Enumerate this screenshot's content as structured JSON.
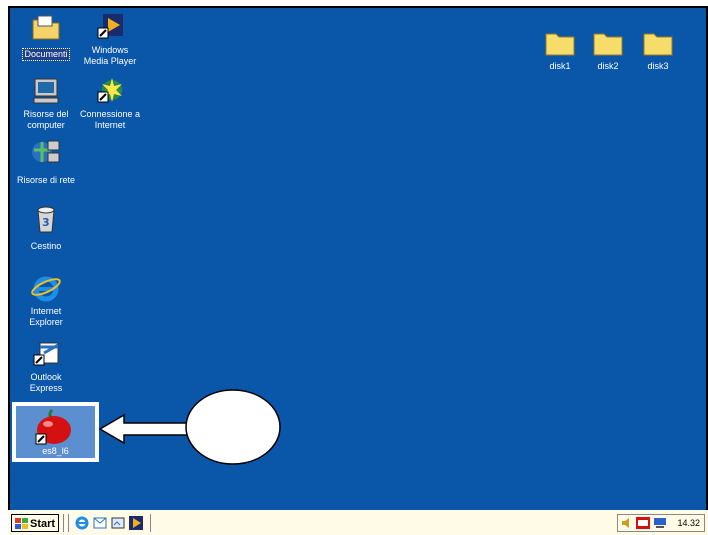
{
  "desktop": {
    "icons_left": [
      {
        "label": "Documenti",
        "icon": "folder-documents-icon"
      },
      {
        "label": "Windows\nMedia Player",
        "icon": "media-player-icon"
      },
      {
        "label": "Risorse del\ncomputer",
        "icon": "computer-icon"
      },
      {
        "label": "Connessione a\nInternet",
        "icon": "internet-connection-icon"
      },
      {
        "label": "Risorse di rete",
        "icon": "network-icon"
      },
      {
        "label": "Cestino",
        "icon": "recycle-bin-icon"
      },
      {
        "label": "Internet\nExplorer",
        "icon": "internet-explorer-icon"
      },
      {
        "label": "Outlook\nExpress",
        "icon": "outlook-express-icon"
      },
      {
        "label": "es8_l6",
        "icon": "apple-shortcut-icon"
      }
    ],
    "folders": [
      {
        "label": "disk1"
      },
      {
        "label": "disk2"
      },
      {
        "label": "disk3"
      }
    ]
  },
  "taskbar": {
    "start_label": "Start",
    "clock": "14.32"
  },
  "colors": {
    "desktop": "#0a56a8",
    "taskbar": "#fffbe6"
  }
}
